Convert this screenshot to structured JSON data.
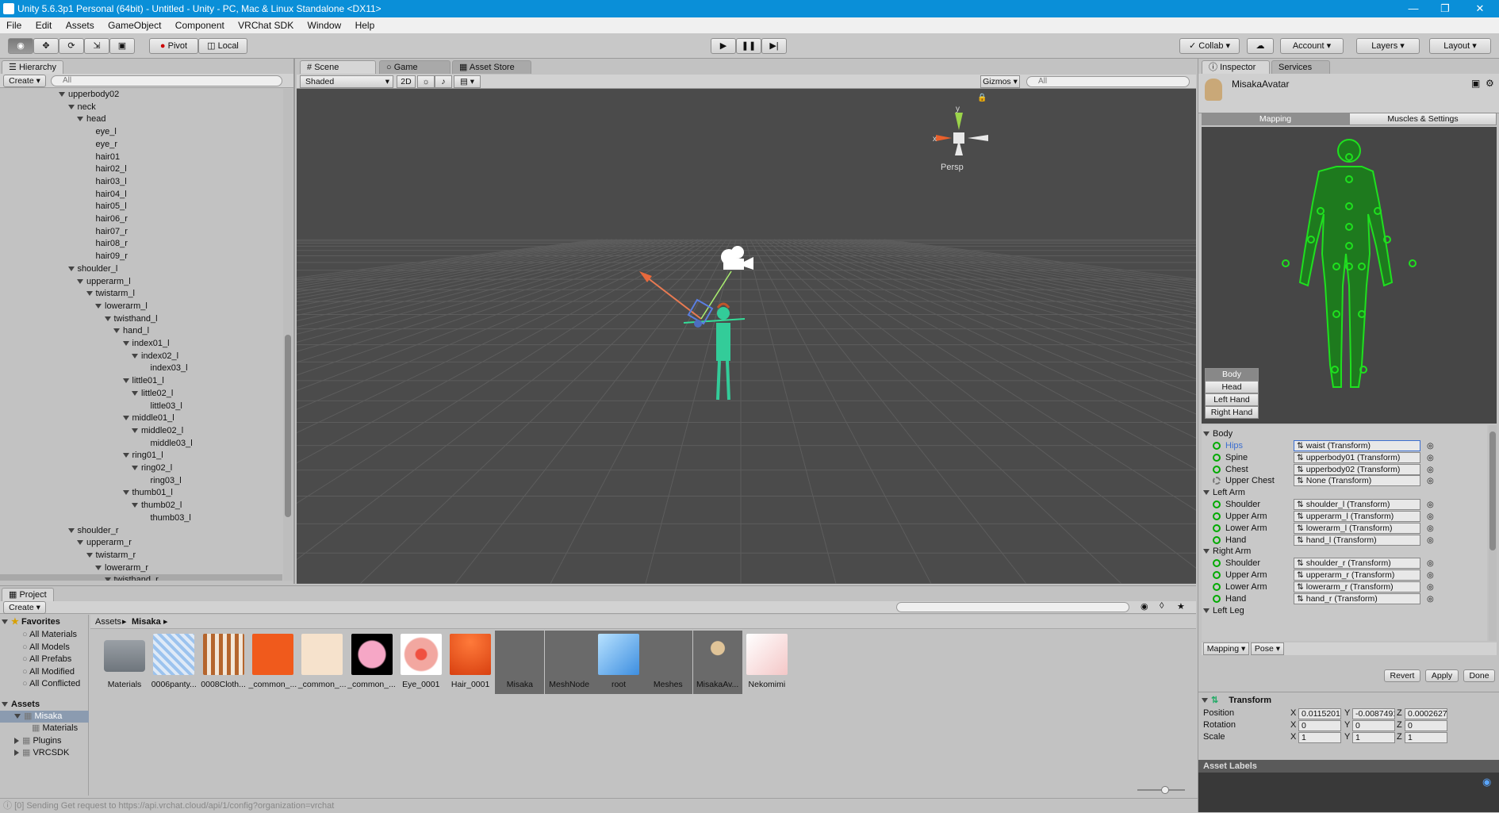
{
  "window": {
    "title": "Unity 5.6.3p1 Personal (64bit) - Untitled - Unity - PC, Mac & Linux Standalone <DX11>"
  },
  "menu": [
    "File",
    "Edit",
    "Assets",
    "GameObject",
    "Component",
    "VRChat SDK",
    "Window",
    "Help"
  ],
  "toolbar": {
    "pivot": "Pivot",
    "local": "Local",
    "collab": "Collab",
    "account": "Account",
    "layers": "Layers",
    "layout": "Layout"
  },
  "hierarchy": {
    "tab": "Hierarchy",
    "create": "Create",
    "search_placeholder": "All",
    "items": [
      {
        "label": "upperbody02",
        "depth": 0,
        "exp": true
      },
      {
        "label": "neck",
        "depth": 1,
        "exp": true
      },
      {
        "label": "head",
        "depth": 2,
        "exp": true
      },
      {
        "label": "eye_l",
        "depth": 3
      },
      {
        "label": "eye_r",
        "depth": 3
      },
      {
        "label": "hair01",
        "depth": 3
      },
      {
        "label": "hair02_l",
        "depth": 3
      },
      {
        "label": "hair03_l",
        "depth": 3
      },
      {
        "label": "hair04_l",
        "depth": 3
      },
      {
        "label": "hair05_l",
        "depth": 3
      },
      {
        "label": "hair06_r",
        "depth": 3
      },
      {
        "label": "hair07_r",
        "depth": 3
      },
      {
        "label": "hair08_r",
        "depth": 3
      },
      {
        "label": "hair09_r",
        "depth": 3
      },
      {
        "label": "shoulder_l",
        "depth": 1,
        "exp": true
      },
      {
        "label": "upperarm_l",
        "depth": 2,
        "exp": true
      },
      {
        "label": "twistarm_l",
        "depth": 3,
        "exp": true
      },
      {
        "label": "lowerarm_l",
        "depth": 4,
        "exp": true
      },
      {
        "label": "twisthand_l",
        "depth": 5,
        "exp": true
      },
      {
        "label": "hand_l",
        "depth": 6,
        "exp": true
      },
      {
        "label": "index01_l",
        "depth": 7,
        "exp": true
      },
      {
        "label": "index02_l",
        "depth": 8,
        "exp": true
      },
      {
        "label": "index03_l",
        "depth": 9
      },
      {
        "label": "little01_l",
        "depth": 7,
        "exp": true
      },
      {
        "label": "little02_l",
        "depth": 8,
        "exp": true
      },
      {
        "label": "little03_l",
        "depth": 9
      },
      {
        "label": "middle01_l",
        "depth": 7,
        "exp": true
      },
      {
        "label": "middle02_l",
        "depth": 8,
        "exp": true
      },
      {
        "label": "middle03_l",
        "depth": 9
      },
      {
        "label": "ring01_l",
        "depth": 7,
        "exp": true
      },
      {
        "label": "ring02_l",
        "depth": 8,
        "exp": true
      },
      {
        "label": "ring03_l",
        "depth": 9
      },
      {
        "label": "thumb01_l",
        "depth": 7,
        "exp": true
      },
      {
        "label": "thumb02_l",
        "depth": 8,
        "exp": true
      },
      {
        "label": "thumb03_l",
        "depth": 9
      },
      {
        "label": "shoulder_r",
        "depth": 1,
        "exp": true
      },
      {
        "label": "upperarm_r",
        "depth": 2,
        "exp": true
      },
      {
        "label": "twistarm_r",
        "depth": 3,
        "exp": true
      },
      {
        "label": "lowerarm_r",
        "depth": 4,
        "exp": true
      },
      {
        "label": "twisthand_r",
        "depth": 5,
        "exp": true,
        "sel": true
      }
    ]
  },
  "scene": {
    "tabs": [
      "Scene",
      "Game",
      "Asset Store"
    ],
    "shading": "Shaded",
    "mode2d": "2D",
    "gizmos": "Gizmos",
    "search_placeholder": "All",
    "persp": "Persp"
  },
  "inspector": {
    "tabs": [
      "Inspector",
      "Services"
    ],
    "object": "MisakaAvatar",
    "subtabs": [
      "Mapping",
      "Muscles & Settings"
    ],
    "body_buttons": [
      "Body",
      "Head",
      "Left Hand",
      "Right Hand"
    ],
    "groups": [
      {
        "name": "Body",
        "bones": [
          {
            "label": "Hips",
            "value": "waist (Transform)",
            "sel": true
          },
          {
            "label": "Spine",
            "value": "upperbody01 (Transform)"
          },
          {
            "label": "Chest",
            "value": "upperbody02 (Transform)"
          },
          {
            "label": "Upper Chest",
            "value": "None (Transform)",
            "empty": true
          }
        ]
      },
      {
        "name": "Left Arm",
        "bones": [
          {
            "label": "Shoulder",
            "value": "shoulder_l (Transform)"
          },
          {
            "label": "Upper Arm",
            "value": "upperarm_l (Transform)"
          },
          {
            "label": "Lower Arm",
            "value": "lowerarm_l (Transform)"
          },
          {
            "label": "Hand",
            "value": "hand_l (Transform)"
          }
        ]
      },
      {
        "name": "Right Arm",
        "bones": [
          {
            "label": "Shoulder",
            "value": "shoulder_r (Transform)"
          },
          {
            "label": "Upper Arm",
            "value": "upperarm_r (Transform)"
          },
          {
            "label": "Lower Arm",
            "value": "lowerarm_r (Transform)"
          },
          {
            "label": "Hand",
            "value": "hand_r (Transform)"
          }
        ]
      },
      {
        "name": "Left Leg",
        "bones": []
      }
    ],
    "bottom_dropdowns": [
      "Mapping",
      "Pose"
    ],
    "actions": {
      "revert": "Revert",
      "apply": "Apply",
      "done": "Done"
    },
    "transform": {
      "title": "Transform",
      "rows": [
        {
          "label": "Position",
          "x": "0.0115201",
          "y": "-0.0087491",
          "z": "0.0002627"
        },
        {
          "label": "Rotation",
          "x": "0",
          "y": "0",
          "z": "0"
        },
        {
          "label": "Scale",
          "x": "1",
          "y": "1",
          "z": "1"
        }
      ]
    },
    "asset_labels": "Asset Labels"
  },
  "project": {
    "tab": "Project",
    "create": "Create",
    "favorites": {
      "title": "Favorites",
      "items": [
        "All Materials",
        "All Models",
        "All Prefabs",
        "All Modified",
        "All Conflicted"
      ]
    },
    "assets_tree": {
      "title": "Assets",
      "items": [
        {
          "label": "Misaka",
          "depth": 1,
          "sel": true
        },
        {
          "label": "Materials",
          "depth": 2
        },
        {
          "label": "Plugins",
          "depth": 1
        },
        {
          "label": "VRCSDK",
          "depth": 1
        }
      ]
    },
    "breadcrumb": [
      "Assets",
      "Misaka"
    ],
    "assets": [
      {
        "label": "Materials",
        "kind": "folder"
      },
      {
        "label": "0006panty...",
        "kind": "pattern-blue"
      },
      {
        "label": "0008Cloth...",
        "kind": "pattern-brown"
      },
      {
        "label": "_common_...",
        "kind": "orange"
      },
      {
        "label": "_common_...",
        "kind": "peach"
      },
      {
        "label": "_common_...",
        "kind": "pink-eye"
      },
      {
        "label": "Eye_0001",
        "kind": "eye"
      },
      {
        "label": "Hair_0001",
        "kind": "hair"
      },
      {
        "label": "Misaka",
        "kind": "model"
      },
      {
        "label": "MeshNode",
        "kind": "model-small"
      },
      {
        "label": "root",
        "kind": "cube"
      },
      {
        "label": "Meshes",
        "kind": "model-dark"
      },
      {
        "label": "MisakaAv...",
        "kind": "avatar"
      },
      {
        "label": "Nekomimi",
        "kind": "pink"
      }
    ]
  },
  "status": {
    "text": "[0] Sending Get request to https://api.vrchat.cloud/api/1/config?organization=vrchat"
  }
}
